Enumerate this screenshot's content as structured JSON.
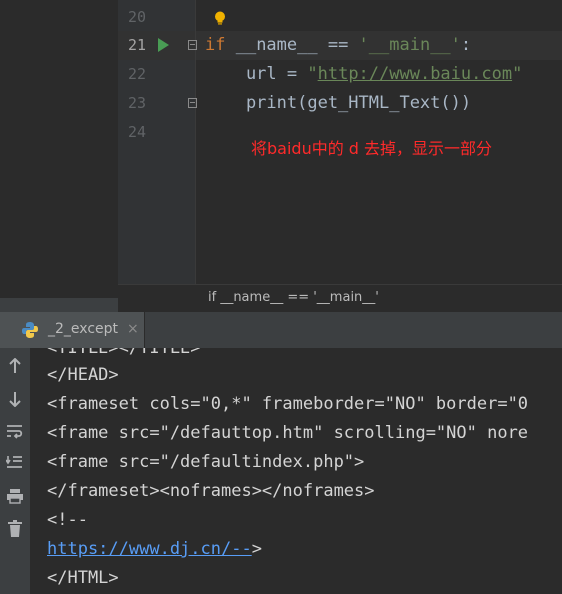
{
  "editor": {
    "line_numbers": [
      "20",
      "21",
      "22",
      "23",
      "24"
    ],
    "active_line": "21",
    "code": {
      "line21_if": "if",
      "line21_name": " __name__ == ",
      "line21_main": "'__main__'",
      "line21_colon": ":",
      "line22_prefix": "    url = ",
      "line22_q1": "\"",
      "line22_url": "http://www.baiu.com",
      "line22_q2": "\"",
      "line23": "    print(get_HTML_Text())"
    },
    "annotation": "将baidu中的 d 去掉，显示一部分",
    "breadcrumb": "if __name__ == '__main__'"
  },
  "run_panel": {
    "tab_label": "_2_except",
    "tab_close": "×",
    "console_lines": [
      "<TITLE></TITLE>",
      "</HEAD>",
      "<frameset cols=\"0,*\" frameborder=\"NO\" border=\"0",
      "<frame src=\"/defauttop.htm\" scrolling=\"NO\" nore",
      "<frame src=\"/defaultindex.php\">",
      "</frameset><noframes></noframes>",
      "<!--"
    ],
    "console_link": "https://www.dj.cn/--",
    "console_link_suffix": ">",
    "console_last": "</HTML>"
  },
  "colors": {
    "keyword": "#cc7832",
    "string": "#6a8759",
    "link": "#589df6",
    "annotation": "#ff2a2a",
    "run_arrow": "#499c54"
  },
  "icons": [
    "lightbulb-icon",
    "run-arrow-icon",
    "fold-icon",
    "python-icon",
    "arrow-up-icon",
    "arrow-down-icon",
    "soft-wrap-icon",
    "scroll-to-end-icon",
    "print-icon",
    "trash-icon"
  ]
}
